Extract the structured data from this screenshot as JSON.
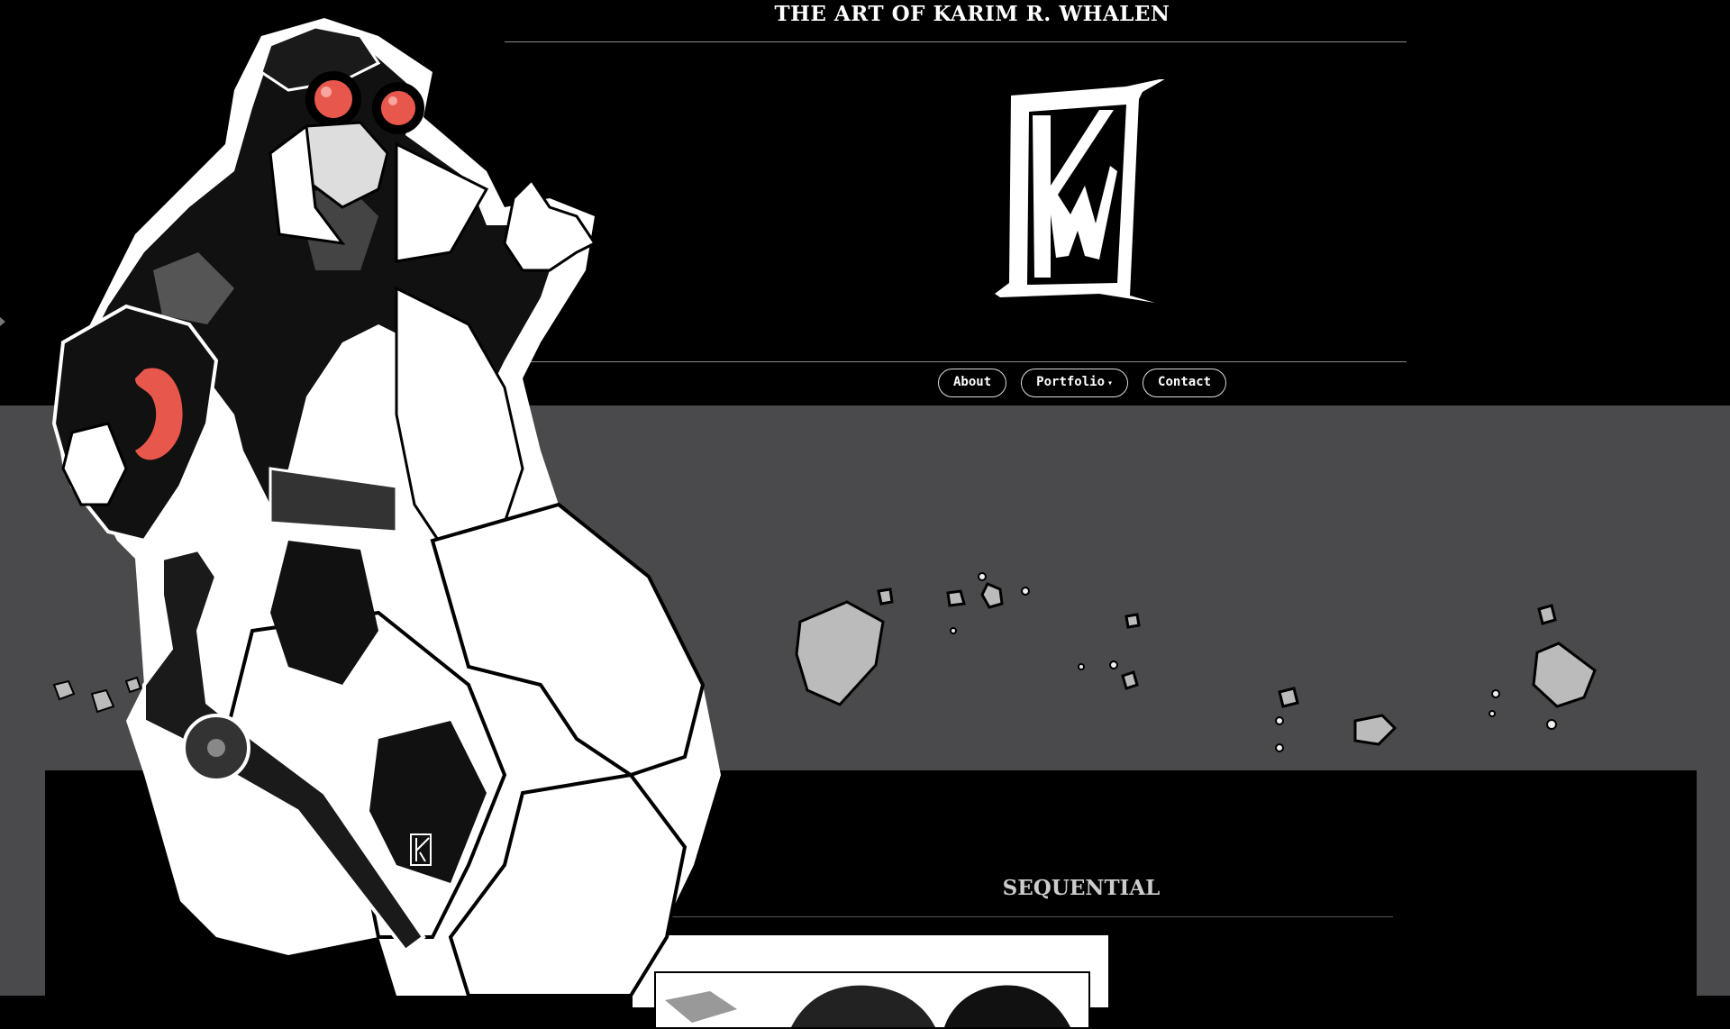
{
  "site": {
    "title": "THE ART OF KARIM R. WHALEN",
    "logo": "kw-monogram",
    "nav": [
      {
        "label": "About"
      },
      {
        "label": "Portfolio",
        "has_dropdown": true
      },
      {
        "label": "Contact"
      }
    ]
  },
  "section": {
    "title": "SEQUENTIAL"
  },
  "colors": {
    "background": "#000000",
    "band": "#4a4a4c",
    "accent_red": "#e8574c",
    "text": "#ffffff"
  },
  "icons": {
    "dropdown": "caret-down-icon",
    "side": "chevron-right-icon"
  }
}
